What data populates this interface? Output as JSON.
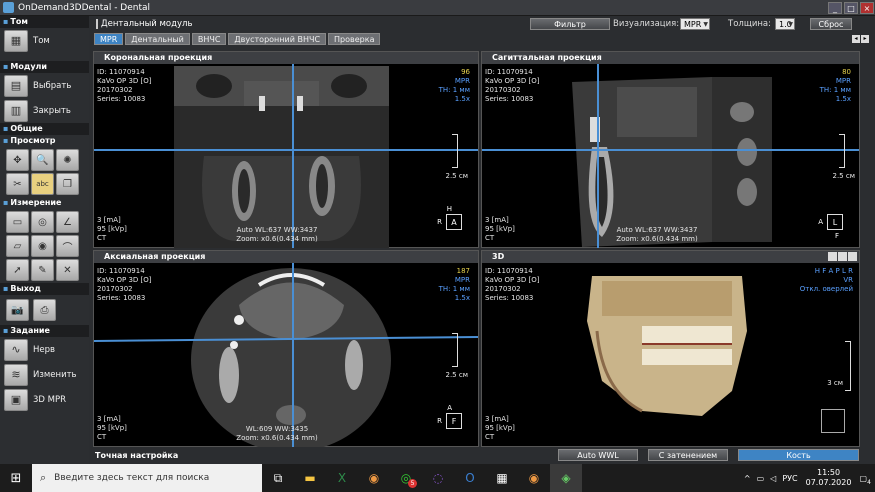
{
  "window": {
    "title": "OnDemand3DDental - Dental"
  },
  "sidebar": {
    "sections": {
      "tom": "Том",
      "modules": "Модули",
      "general": "Общие",
      "view": "Просмотр",
      "measure": "Измерение",
      "exit": "Выход",
      "task": "Задание"
    },
    "tom_button": "Том",
    "select_button": "Выбрать",
    "close_button": "Закрыть",
    "task_items": [
      "Нерв",
      "Изменить",
      "3D MPR"
    ]
  },
  "topbar": {
    "module_title": "Дентальный модуль",
    "filter_button": "Фильтр",
    "visualization_label": "Визуализация:",
    "visualization_value": "MPR",
    "thickness_label": "Толщина:",
    "thickness_value": "1.0",
    "reset_button": "Сброс"
  },
  "tabs": [
    "MPR",
    "Дентальный",
    "ВНЧС",
    "Двусторонний ВНЧС",
    "Проверка"
  ],
  "panes": {
    "coronal": {
      "title": "Корональная проекция",
      "info": [
        "ID: 11070914",
        "KaVo OP 3D [O]",
        "20170302",
        "Series: 10083"
      ],
      "right": [
        "96",
        "MPR",
        "TH: 1 мм",
        "1.5x"
      ],
      "bottom_left": [
        "3 [mA]",
        "95 [kVp]",
        "CT"
      ],
      "wl": "Auto WL:637 WW:3437",
      "zoom": "Zoom: x0.6(0.434 mm)",
      "scale": "2.5 см",
      "orient_top": "H",
      "orient_box": "A",
      "orient_left": "R"
    },
    "sagittal": {
      "title": "Сагиттальная проекция",
      "info": [
        "ID: 11070914",
        "KaVo OP 3D [O]",
        "20170302",
        "Series: 10083"
      ],
      "right": [
        "80",
        "MPR",
        "TH: 1 мм",
        "1.5x"
      ],
      "bottom_left": [
        "3 [mA]",
        "95 [kVp]",
        "CT"
      ],
      "wl": "Auto WL:637 WW:3437",
      "zoom": "Zoom: x0.6(0.434 mm)",
      "scale": "2.5 см",
      "orient_box": "L",
      "orient_left": "A",
      "orient_bottom": "F"
    },
    "axial": {
      "title": "Аксиальная проекция",
      "info": [
        "ID: 11070914",
        "KaVo OP 3D [O]",
        "20170302",
        "Series: 10083"
      ],
      "right": [
        "187",
        "MPR",
        "TH: 1 мм",
        "1.5x"
      ],
      "bottom_left": [
        "3 [mA]",
        "95 [kVp]",
        "CT"
      ],
      "wl": "WL:609 WW:3435",
      "zoom": "Zoom: x0.6(0.434 mm)",
      "scale": "2.5 см",
      "orient_top": "A",
      "orient_box": "F",
      "orient_left": "R"
    },
    "threed": {
      "title": "3D",
      "info": [
        "ID: 11070914",
        "KaVo OP 3D [O]",
        "20170302",
        "Series: 10083"
      ],
      "right": [
        "H F A P L R",
        "VR",
        "Откл. оверлей"
      ],
      "bottom_left": [
        "3 [mA]",
        "95 [kVp]",
        "CT"
      ],
      "scale": "3 см"
    }
  },
  "bottombar": {
    "fine_tune": "Точная настройка",
    "auto_wwl": "Auto WWL",
    "shading": "С затенением",
    "bone": "Кость"
  },
  "taskbar": {
    "search_placeholder": "Введите здесь текст для поиска",
    "lang": "РУС",
    "time": "11:50",
    "date": "07.07.2020",
    "notif": "4",
    "badge": "5"
  }
}
